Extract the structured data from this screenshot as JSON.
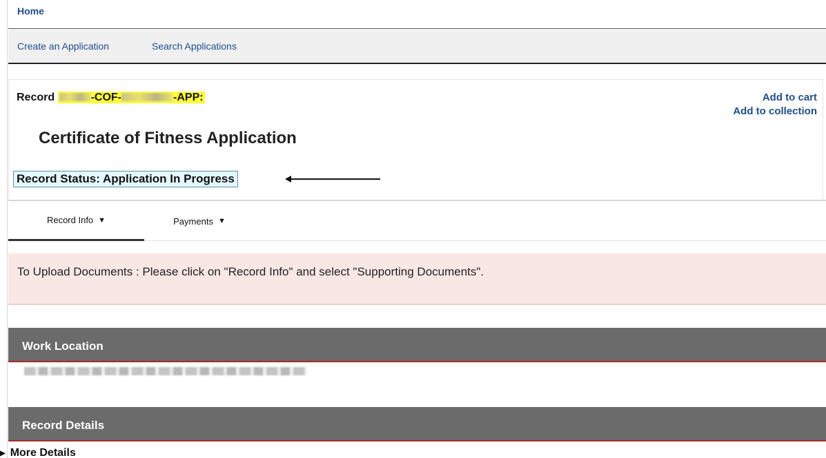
{
  "topnav": {
    "home_label": "Home"
  },
  "subnav": {
    "create_label": "Create an Application",
    "search_label": "Search Applications"
  },
  "record": {
    "prefix_label": "Record",
    "id_part_1": "-COF-",
    "id_part_2": "-APP:",
    "add_to_cart": "Add to cart",
    "add_to_collection": "Add to collection",
    "title": "Certificate of Fitness Application",
    "status": "Record Status: Application In Progress"
  },
  "tabs": [
    {
      "label": "Record Info"
    },
    {
      "label": "Payments"
    }
  ],
  "icons": {
    "dropdown": "caret-down-icon",
    "expand": "caret-right-icon",
    "pointer": "left-arrow-icon"
  },
  "notice": {
    "text": "To Upload Documents : Please click on \"Record Info\" and select \"Supporting Documents\"."
  },
  "sections": {
    "work_location": "Work Location",
    "record_details": "Record Details",
    "more_details": "More Details"
  },
  "colors": {
    "link": "#1f4e8c",
    "highlight": "#ffff33",
    "status_background": "#e4f7fb",
    "notice_background": "#f8e7e5",
    "section_header": "#6b6b6b",
    "section_rule": "#a52a2a"
  }
}
